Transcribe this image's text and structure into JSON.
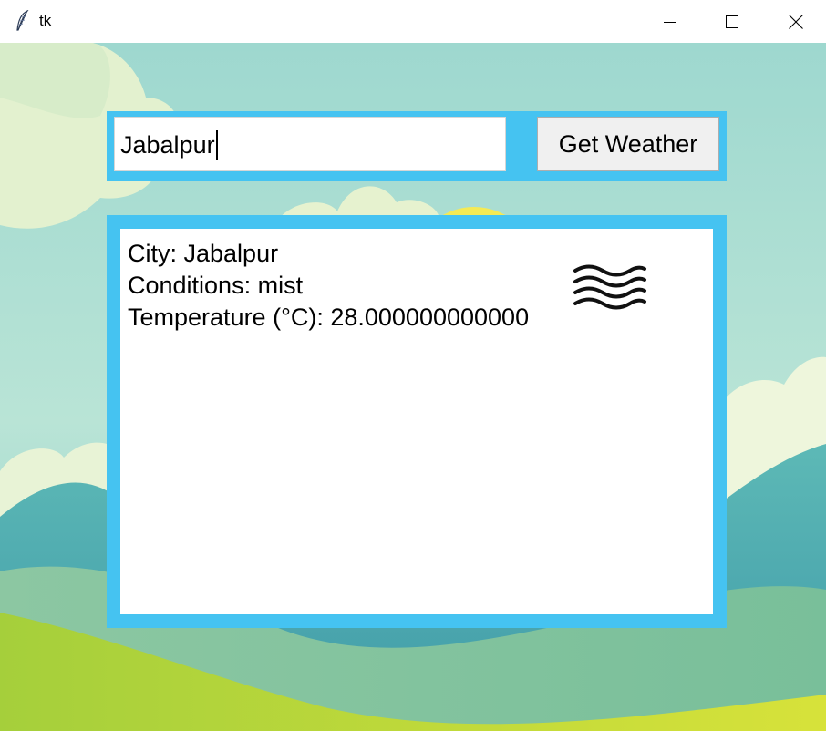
{
  "window": {
    "title": "tk",
    "icon": "feather-icon",
    "controls": [
      "minimize-icon",
      "maximize-icon",
      "close-icon"
    ]
  },
  "search": {
    "value": "Jabalpur",
    "button_label": "Get Weather"
  },
  "result": {
    "city_line": "City: Jabalpur",
    "conditions_line": "Conditions: mist",
    "temperature_line": "Temperature (°C): 28.000000000000",
    "weather_icon": "mist-icon"
  },
  "colors": {
    "frame_accent": "#45c3f1",
    "button_bg": "#f0f0f0",
    "panel_bg": "#ffffff"
  }
}
